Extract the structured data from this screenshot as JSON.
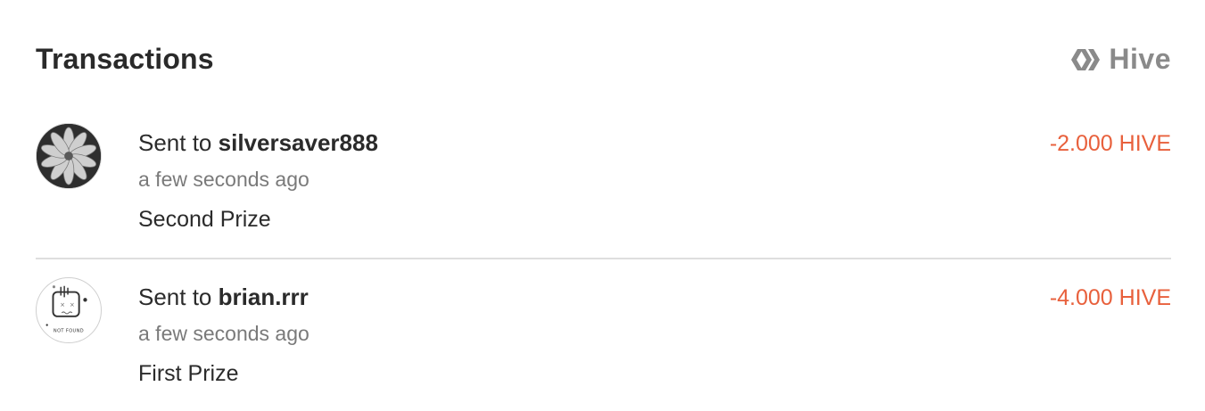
{
  "header": {
    "title": "Transactions",
    "brand_icon": "hive-logo-icon",
    "brand_label": "Hive"
  },
  "transactions": [
    {
      "prefix": "Sent to",
      "recipient": "silversaver888",
      "time": "a few seconds ago",
      "memo": "Second Prize",
      "amount": "-2.000 HIVE",
      "avatar": "profile-photo"
    },
    {
      "prefix": "Sent to",
      "recipient": "brian.rrr",
      "time": "a few seconds ago",
      "memo": "First Prize",
      "amount": "-4.000 HIVE",
      "avatar": "not-found-placeholder",
      "avatar_text": "NOT FOUND"
    }
  ],
  "colors": {
    "amount": "#e8603c",
    "title": "#2a2a2a",
    "muted": "#7a7a7a",
    "brand": "#8a8a8a",
    "divider": "#dedede"
  }
}
